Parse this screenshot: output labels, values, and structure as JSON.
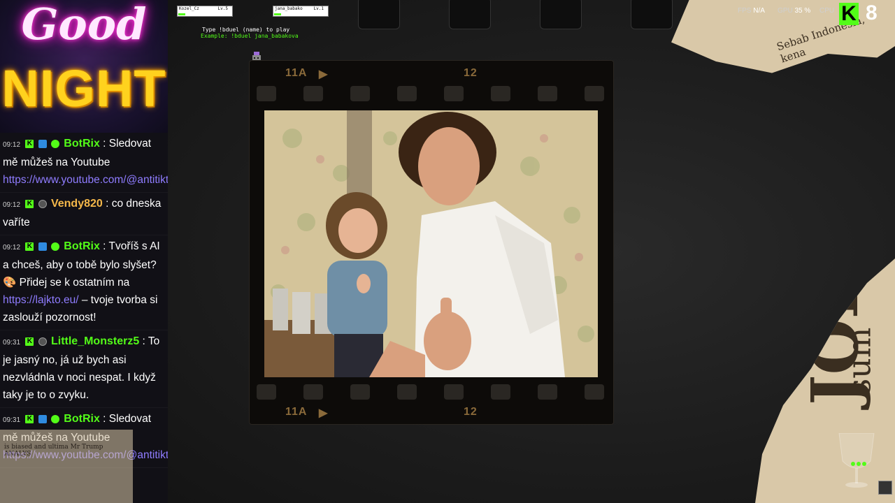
{
  "logo": {
    "line1": "Good",
    "line2": "NIGHT"
  },
  "chat": {
    "messages": [
      {
        "time": "09:12",
        "badges": [
          "kick-icon",
          "bot-icon",
          "verified-icon"
        ],
        "username": "BotRix",
        "user_color": "#53fc18",
        "text": "Sledovat mě můžeš na Youtube",
        "link": "https://www.youtube.com/@antitiktokercz"
      },
      {
        "time": "09:12",
        "badges": [
          "kick-icon",
          "moderator-icon"
        ],
        "username": "Vendy820",
        "user_color": "#f5b84a",
        "text": "co dneska vaříte",
        "link": ""
      },
      {
        "time": "09:12",
        "badges": [
          "kick-icon",
          "bot-icon",
          "verified-icon"
        ],
        "username": "BotRix",
        "user_color": "#53fc18",
        "text": "Tvoříš s AI a chceš, aby o tobě bylo slyšet? 🎨 Přidej se k ostatním na",
        "link": "https://lajkto.eu/",
        "text_after": "– tvoje tvorba si zaslouží pozornost!"
      },
      {
        "time": "09:31",
        "badges": [
          "kick-icon",
          "moderator-icon"
        ],
        "username": "Little_Monsterz5",
        "user_color": "#53fc18",
        "text": "To je jasný no, já už bych asi nezvládnla v noci nespat. I když taky je to o zvyku.",
        "link": ""
      },
      {
        "time": "09:31",
        "badges": [
          "kick-icon",
          "bot-icon",
          "verified-icon"
        ],
        "username": "BotRix",
        "user_color": "#53fc18",
        "text": "Sledovat mě můžeš na Youtube",
        "link": "https://www.youtube.com/@antitiktokercz"
      }
    ]
  },
  "game": {
    "players": [
      {
        "name": "Kozel_Cz",
        "level": "Lv.5"
      },
      {
        "name": "jana_babako",
        "level": "Lv.1"
      }
    ],
    "instruction": "Type !bduel (name) to play",
    "example": "Example: !bduel jana_babakova"
  },
  "film": {
    "frame_top_left": "11A",
    "frame_top_right": "12",
    "frame_bottom_left": "11A",
    "frame_bottom_right": "12"
  },
  "hud": {
    "fps_label": "FPS",
    "fps_value": "N/A",
    "gpu_label": "GPU",
    "gpu_value": "35 %",
    "cpu_label": "CPU",
    "viewer_count": "8"
  },
  "newspaper": {
    "headline_fragment": "JOB",
    "word_fragment": "sum",
    "text_top": "Sebab Indonesia, kena",
    "text_bottom": "is biased and ultima Mr Trump ANALYS"
  },
  "colors": {
    "kick_green": "#53fc18",
    "link_purple": "#8f7cff",
    "username_orange": "#f5b84a"
  }
}
